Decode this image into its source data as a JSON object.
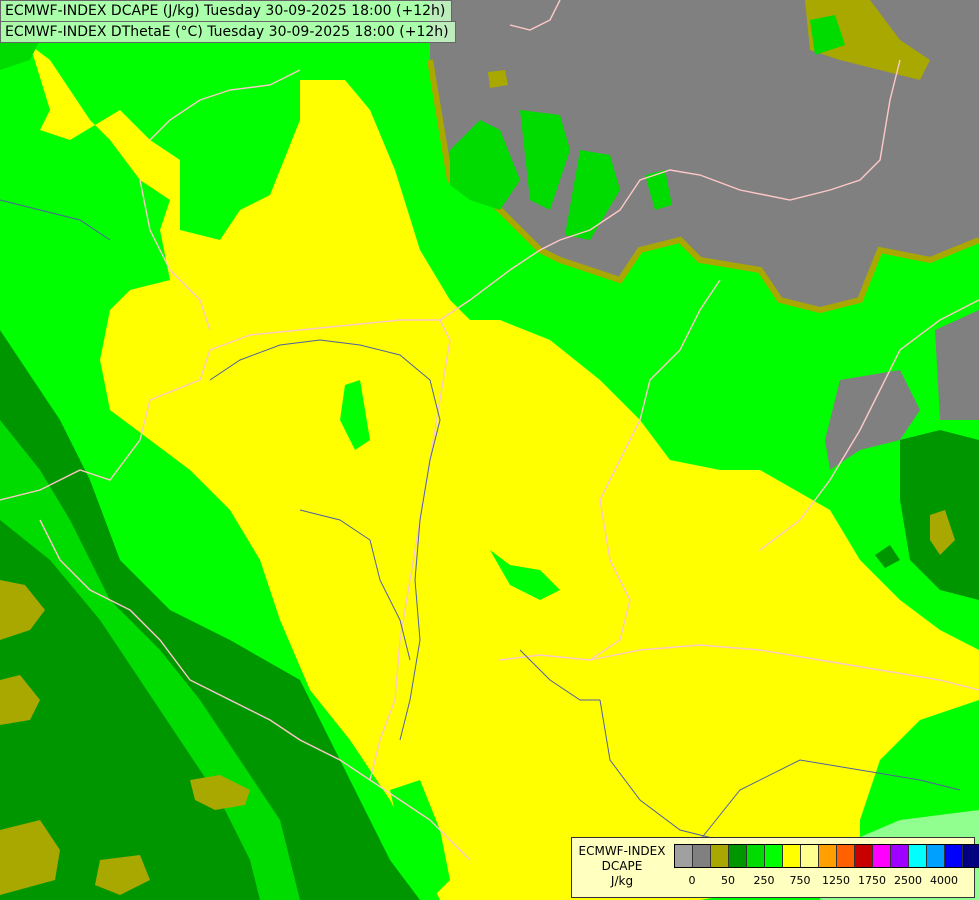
{
  "titles": {
    "line1": "ECMWF-INDEX DCAPE (J/kg) Tuesday 30-09-2025 18:00 (+12h)",
    "line2": "ECMWF-INDEX DThetaE (°C) Tuesday 30-09-2025 18:00 (+12h)"
  },
  "legend": {
    "line1": "ECMWF-INDEX",
    "line2": "DCAPE",
    "line3": "J/kg",
    "colors": [
      "#a0a0a0",
      "#808080",
      "#a8a800",
      "#009600",
      "#00dc00",
      "#00ff00",
      "#ffff00",
      "#ffff90",
      "#ffa000",
      "#ff6000",
      "#c80000",
      "#ff00ff",
      "#a000ff",
      "#00ffff",
      "#00a0ff",
      "#0000ff",
      "#000080"
    ],
    "ticks": [
      "0",
      "50",
      "250",
      "750",
      "1250",
      "1750",
      "2500",
      "4000"
    ]
  },
  "map_fill": {
    "yellow": "#ffff00",
    "bright_green": "#00ff00",
    "mid_green": "#00dc00",
    "dark_green": "#009600",
    "olive": "#a8a800",
    "gray": "#808080",
    "light_green": "#90ff90"
  }
}
